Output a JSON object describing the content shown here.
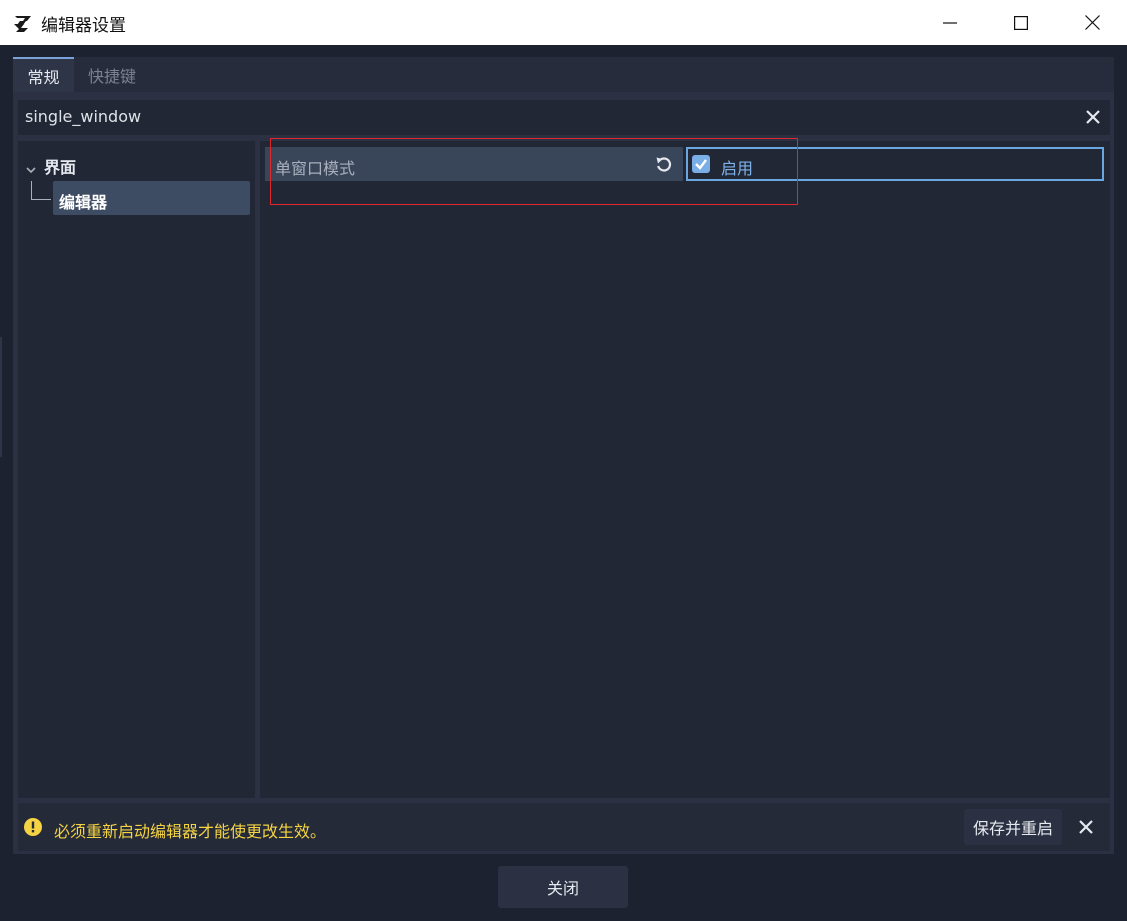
{
  "window": {
    "title": "编辑器设置"
  },
  "tabs": [
    {
      "label": "常规",
      "active": true
    },
    {
      "label": "快捷键",
      "active": false
    }
  ],
  "search": {
    "value": "single_window"
  },
  "tree": {
    "section_label": "界面",
    "selected_item_label": "编辑器"
  },
  "inspector": {
    "property_label": "单窗口模式",
    "checkbox_checked": true,
    "value_label": "启用"
  },
  "warning": {
    "message": "必须重新启动编辑器才能使更改生效。",
    "save_button_label": "保存并重启"
  },
  "footer": {
    "close_button_label": "关闭"
  },
  "colors": {
    "accent": "#6aa6e0",
    "warning_text": "#f5d343",
    "highlight_box": "#e0272c"
  }
}
